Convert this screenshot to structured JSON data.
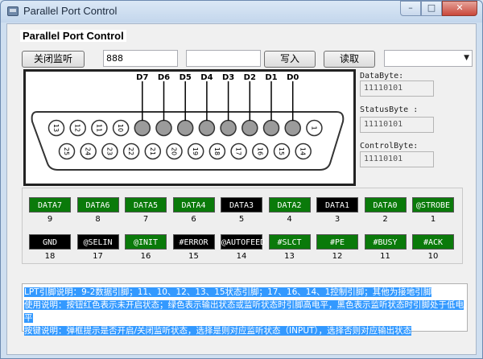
{
  "window": {
    "title": "Parallel Port Control"
  },
  "group": {
    "title": "Parallel Port Control"
  },
  "toolbar": {
    "close_monitor_label": "关闭监听",
    "input1_value": "888",
    "input2_value": "",
    "write_label": "写入",
    "read_label": "读取",
    "combo_value": ""
  },
  "connector": {
    "data_labels": [
      "D7",
      "D6",
      "D5",
      "D4",
      "D3",
      "D2",
      "D1",
      "D0"
    ],
    "top_pins": [
      "13",
      "12",
      "11",
      "10",
      "9",
      "8",
      "7",
      "6",
      "5",
      "4",
      "3",
      "2",
      "1"
    ],
    "bottom_pins": [
      "25",
      "24",
      "23",
      "22",
      "21",
      "20",
      "19",
      "18",
      "17",
      "16",
      "15",
      "14"
    ]
  },
  "bytes": {
    "data_label": "DataByte:",
    "data_value": "11110101",
    "status_label": "StatusByte :",
    "status_value": "11110101",
    "control_label": "ControlByte:",
    "control_value": "11110101"
  },
  "signals_row1": [
    {
      "label": "DATA7",
      "pin": "9",
      "state": "green"
    },
    {
      "label": "DATA6",
      "pin": "8",
      "state": "green"
    },
    {
      "label": "DATA5",
      "pin": "7",
      "state": "green"
    },
    {
      "label": "DATA4",
      "pin": "6",
      "state": "green"
    },
    {
      "label": "DATA3",
      "pin": "5",
      "state": "black"
    },
    {
      "label": "DATA2",
      "pin": "4",
      "state": "green"
    },
    {
      "label": "DATA1",
      "pin": "3",
      "state": "black"
    },
    {
      "label": "DATA0",
      "pin": "2",
      "state": "green"
    },
    {
      "label": "@STROBE",
      "pin": "1",
      "state": "green"
    }
  ],
  "signals_row2": [
    {
      "label": "GND",
      "pin": "18",
      "state": "black"
    },
    {
      "label": "@SELIN",
      "pin": "17",
      "state": "black"
    },
    {
      "label": "@INIT",
      "pin": "16",
      "state": "green"
    },
    {
      "label": "#ERROR",
      "pin": "15",
      "state": "black"
    },
    {
      "label": "@AUTOFEED",
      "pin": "14",
      "state": "black"
    },
    {
      "label": "#SLCT",
      "pin": "13",
      "state": "green"
    },
    {
      "label": "#PE",
      "pin": "12",
      "state": "green"
    },
    {
      "label": "#BUSY",
      "pin": "11",
      "state": "green"
    },
    {
      "label": "#ACK",
      "pin": "10",
      "state": "green"
    }
  ],
  "info": {
    "line1": "LPT引脚说明：9-2数据引脚；11、10、12、13、15状态引脚；17、16、14、1控制引脚；其他为接地引脚",
    "line2": "使用说明：按钮红色表示未开启状态；绿色表示输出状态或监听状态时引脚高电平，黑色表示监听状态时引脚处于低电平",
    "line3": "按键说明：弹框提示是否开启/关闭监听状态，选择是则对应监听状态（INPUT），选择否则对应输出状态"
  },
  "colors": {
    "high": "#0a7a0a",
    "low": "#000000",
    "selection": "#3399ff"
  }
}
